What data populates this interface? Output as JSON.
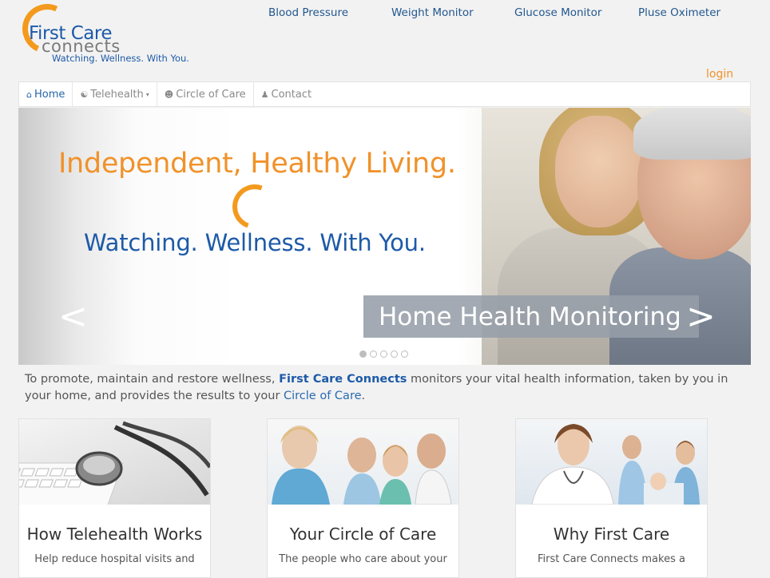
{
  "logo": {
    "first": "First Care",
    "connects": "connects",
    "tagline": "Watching. Wellness. With You."
  },
  "topnav": [
    "Blood Pressure",
    "Weight Monitor",
    "Glucose Monitor",
    "Pluse Oximeter"
  ],
  "login": "login",
  "navbar": {
    "items": [
      {
        "label": "Home",
        "icon": "home-icon",
        "active": true
      },
      {
        "label": "Telehealth",
        "icon": "globe-icon",
        "dropdown": true
      },
      {
        "label": "Circle of Care",
        "icon": "users-icon"
      },
      {
        "label": "Contact",
        "icon": "user-icon"
      }
    ]
  },
  "carousel": {
    "headline": "Independent, Healthy Living.",
    "subline": "Watching. Wellness. With You.",
    "banner": "Home Health Monitoring",
    "prev": "<",
    "next": ">",
    "slide_count": 5,
    "active_slide": 1
  },
  "intro": {
    "part1": "To promote, maintain and restore wellness, ",
    "brand": "First Care Connects",
    "part2": " monitors your vital health information, taken by you in your home, and provides the results to your ",
    "link": "Circle of Care",
    "part3": "."
  },
  "cards": [
    {
      "title": "How Telehealth Works",
      "body": "Help reduce hospital visits and"
    },
    {
      "title": "Your Circle of Care",
      "body": "The people who care about your"
    },
    {
      "title": "Why First Care",
      "body": "First Care Connects makes a"
    }
  ],
  "colors": {
    "brand_blue": "#1d5aa8",
    "brand_orange": "#f0922a",
    "background": "#f2f2f2"
  }
}
